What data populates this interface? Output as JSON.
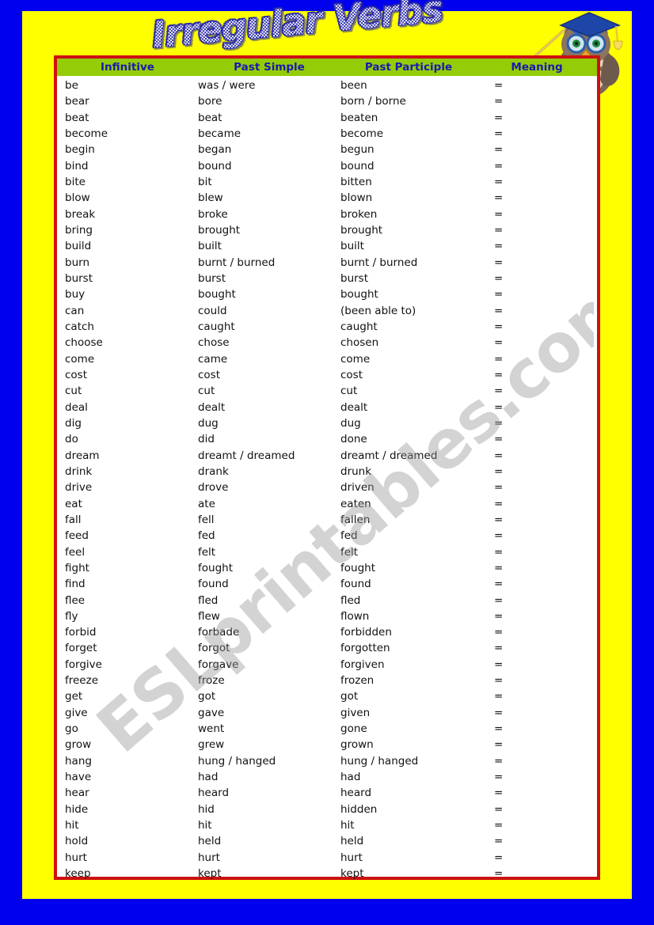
{
  "title": "Irregular Verbs",
  "watermark": "ESLprintables.com",
  "colors": {
    "outer_border": "#0000EE",
    "sheet": "#FFFF00",
    "table_border": "#CC1111",
    "header_band": "#94CC08",
    "header_text": "#1A1AAE",
    "body_text": "#111111",
    "title_fill": "#F27A9E",
    "title_outline": "#2A2AA8"
  },
  "table": {
    "headers": [
      "Infinitive",
      "Past Simple",
      "Past Participle",
      "Meaning"
    ],
    "meaning_marker": "=",
    "rows": [
      [
        "be",
        "was / were",
        "been",
        "="
      ],
      [
        "bear",
        "bore",
        "born / borne",
        "="
      ],
      [
        "beat",
        "beat",
        "beaten",
        "="
      ],
      [
        "become",
        "became",
        "become",
        "="
      ],
      [
        "begin",
        "began",
        "begun",
        "="
      ],
      [
        "bind",
        "bound",
        "bound",
        "="
      ],
      [
        "bite",
        "bit",
        "bitten",
        "="
      ],
      [
        "blow",
        "blew",
        "blown",
        "="
      ],
      [
        "break",
        "broke",
        "broken",
        "="
      ],
      [
        "bring",
        "brought",
        "brought",
        "="
      ],
      [
        "build",
        "built",
        "built",
        "="
      ],
      [
        "burn",
        "burnt / burned",
        "burnt / burned",
        "="
      ],
      [
        "burst",
        "burst",
        "burst",
        "="
      ],
      [
        "buy",
        "bought",
        "bought",
        "="
      ],
      [
        "can",
        "could",
        "(been able to)",
        "="
      ],
      [
        "catch",
        "caught",
        "caught",
        "="
      ],
      [
        "choose",
        "chose",
        "chosen",
        "="
      ],
      [
        "come",
        "came",
        "come",
        "="
      ],
      [
        "cost",
        "cost",
        "cost",
        "="
      ],
      [
        "cut",
        "cut",
        "cut",
        "="
      ],
      [
        "deal",
        "dealt",
        "dealt",
        "="
      ],
      [
        "dig",
        "dug",
        "dug",
        "="
      ],
      [
        "do",
        "did",
        "done",
        "="
      ],
      [
        "dream",
        "dreamt / dreamed",
        "dreamt / dreamed",
        "="
      ],
      [
        "drink",
        "drank",
        "drunk",
        "="
      ],
      [
        "drive",
        "drove",
        "driven",
        "="
      ],
      [
        "eat",
        "ate",
        "eaten",
        "="
      ],
      [
        "fall",
        "fell",
        "fallen",
        "="
      ],
      [
        "feed",
        "fed",
        "fed",
        "="
      ],
      [
        "feel",
        "felt",
        "felt",
        "="
      ],
      [
        "fight",
        "fought",
        "fought",
        "="
      ],
      [
        "find",
        "found",
        "found",
        "="
      ],
      [
        "flee",
        "fled",
        "fled",
        "="
      ],
      [
        "fly",
        "flew",
        "flown",
        "="
      ],
      [
        "forbid",
        "forbade",
        "forbidden",
        "="
      ],
      [
        "forget",
        "forgot",
        "forgotten",
        "="
      ],
      [
        "forgive",
        "forgave",
        "forgiven",
        "="
      ],
      [
        "freeze",
        "froze",
        "frozen",
        "="
      ],
      [
        "get",
        "got",
        "got",
        "="
      ],
      [
        "give",
        "gave",
        "given",
        "="
      ],
      [
        "go",
        "went",
        "gone",
        "="
      ],
      [
        "grow",
        "grew",
        "grown",
        "="
      ],
      [
        "hang",
        "hung / hanged",
        "hung / hanged",
        "="
      ],
      [
        "have",
        "had",
        "had",
        "="
      ],
      [
        "hear",
        "heard",
        "heard",
        "="
      ],
      [
        "hide",
        "hid",
        "hidden",
        "="
      ],
      [
        "hit",
        "hit",
        "hit",
        "="
      ],
      [
        "hold",
        "held",
        "held",
        "="
      ],
      [
        "hurt",
        "hurt",
        "hurt",
        "="
      ],
      [
        "keep",
        "kept",
        "kept",
        "="
      ]
    ]
  },
  "mascot": {
    "name": "owl-teacher",
    "description": "owl with graduation cap, glasses and pointer"
  }
}
